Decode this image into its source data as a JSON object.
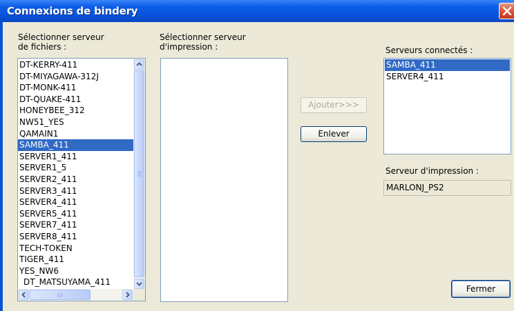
{
  "window": {
    "title": "Connexions de bindery"
  },
  "file_server": {
    "label_line1": "Sélectionner serveur",
    "label_line2": "de fichiers :",
    "items": [
      "DT-KERRY-411",
      "DT-MIYAGAWA-312J",
      "DT-MONK-411",
      "DT-QUAKE-411",
      "HONEYBEE_312",
      "NW51_YES",
      "QAMAIN1",
      "SAMBA_411",
      "SERVER1_411",
      "SERVER1_5",
      "SERVER2_411",
      "SERVER3_411",
      "SERVER4_411",
      "SERVER5_411",
      "SERVER7_411",
      "SERVER8_411",
      "TECH-TOKEN",
      "TIGER_411",
      "YES_NW6",
      "DT_MATSUYAMA_411"
    ],
    "selected": "SAMBA_411"
  },
  "print_server": {
    "label_line1": "Sélectionner serveur",
    "label_line2": "d'impression :"
  },
  "buttons": {
    "add": "Ajouter>>>",
    "remove": "Enlever",
    "close": "Fermer"
  },
  "connected": {
    "label": "Serveurs connectés :",
    "items": [
      "SAMBA_411",
      "SERVER4_411"
    ],
    "selected": "SAMBA_411"
  },
  "print_server_field": {
    "label": "Serveur d'impression :",
    "value": "MARLONJ_PS2"
  }
}
